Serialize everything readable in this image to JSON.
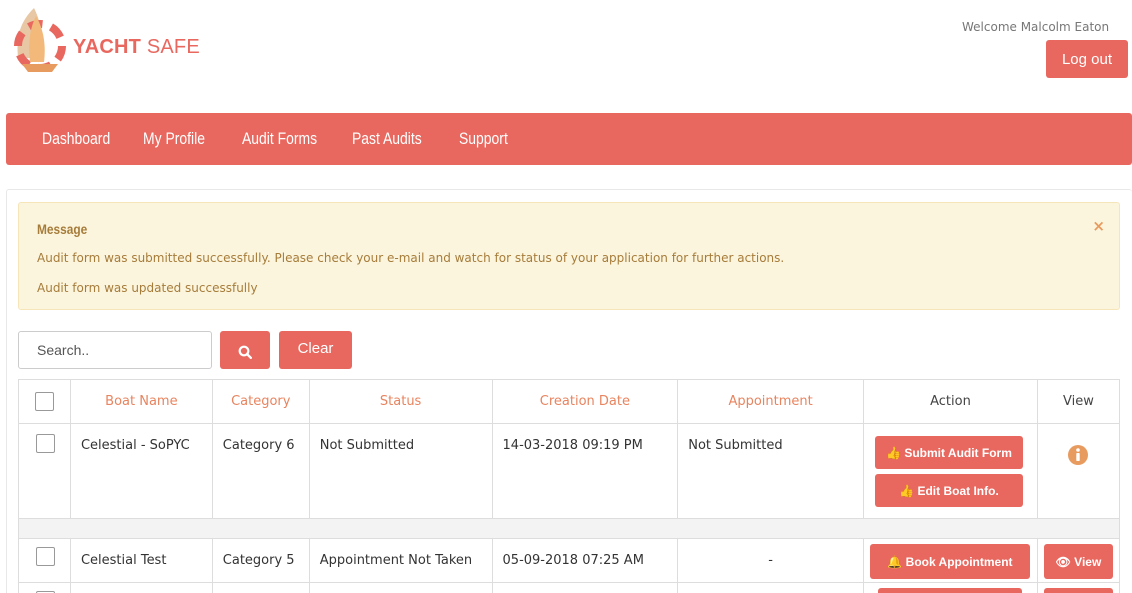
{
  "brand": {
    "name_bold": "YACHT",
    "name_light": "SAFE"
  },
  "user": {
    "welcome": "Welcome Malcolm Eaton",
    "logout_label": "Log out"
  },
  "nav": [
    "Dashboard",
    "My Profile",
    "Audit Forms",
    "Past Audits",
    "Support"
  ],
  "alert": {
    "title": "Message",
    "lines": [
      "Audit form was submitted successfully. Please check your e-mail and watch for status of your application for further actions.",
      "Audit form was updated successfully"
    ],
    "close": "×"
  },
  "search": {
    "placeholder": "Search..",
    "clear_label": "Clear"
  },
  "table": {
    "headers": [
      "Boat Name",
      "Category",
      "Status",
      "Creation Date",
      "Appointment",
      "Action",
      "View"
    ],
    "rows": [
      {
        "boat": "Celestial - SoPYC",
        "category": "Category 6",
        "status": "Not Submitted",
        "created": "14-03-2018 09:19 PM",
        "appointment": "Not Submitted",
        "actions": [
          "Submit Audit Form",
          "Edit Boat Info."
        ],
        "view": "info-icon"
      },
      {
        "boat": "Celestial Test",
        "category": "Category 5",
        "status": "Appointment Not Taken",
        "created": "05-09-2018 07:25 AM",
        "appointment": "-",
        "actions": [
          "Book Appointment"
        ],
        "view_label": "View"
      }
    ]
  },
  "colors": {
    "accent": "#e8685f",
    "alert_bg": "#fcf5dd",
    "alert_text": "#a67c3a",
    "header_text": "#e8845f"
  }
}
